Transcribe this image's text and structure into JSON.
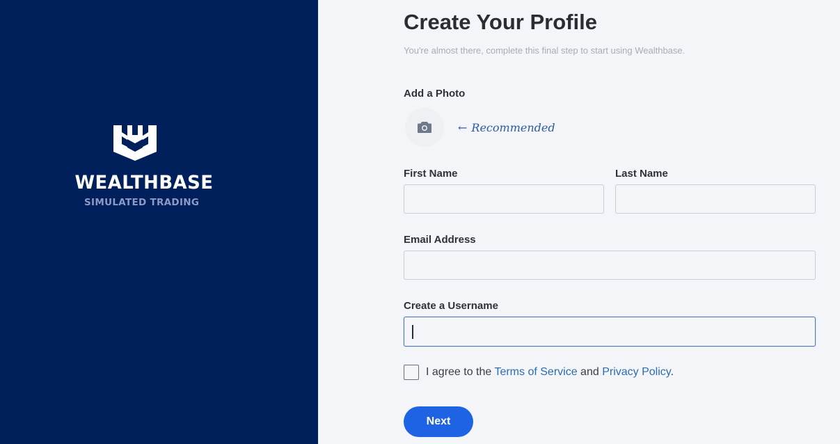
{
  "brand": {
    "name": "WEALTHBASE",
    "tagline": "SIMULATED TRADING",
    "panel_color": "#00205b"
  },
  "page": {
    "title": "Create Your Profile",
    "subtitle": "You're almost there, complete this final step to start using Wealthbase."
  },
  "photo": {
    "label": "Add a Photo",
    "icon": "camera-icon",
    "note_arrow": "←",
    "note": "Recommended"
  },
  "fields": {
    "first_name": {
      "label": "First Name",
      "value": ""
    },
    "last_name": {
      "label": "Last Name",
      "value": ""
    },
    "email": {
      "label": "Email Address",
      "value": ""
    },
    "username": {
      "label": "Create a Username",
      "value": ""
    }
  },
  "agreement": {
    "prefix": "I agree to the ",
    "terms_link": "Terms of Service",
    "middle": " and ",
    "privacy_link": "Privacy Policy",
    "suffix": ".",
    "checked": false
  },
  "actions": {
    "next_label": "Next",
    "accent_color": "#1f63e5"
  }
}
